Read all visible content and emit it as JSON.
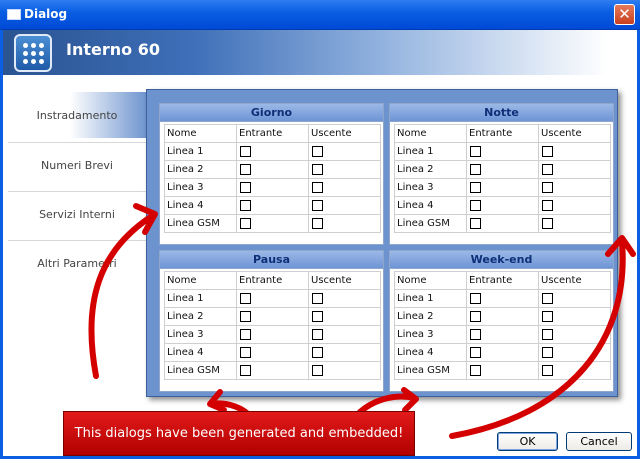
{
  "window": {
    "title": "Dialog",
    "close_label": "✕"
  },
  "header": {
    "title": "Interno 60"
  },
  "nav": {
    "items": [
      {
        "label": "Instradamento",
        "active": true
      },
      {
        "label": "Numeri Brevi",
        "active": false
      },
      {
        "label": "Servizi Interni",
        "active": false
      },
      {
        "label": "Altri Parametri",
        "active": false
      }
    ]
  },
  "columns": {
    "name": "Nome",
    "in": "Entrante",
    "out": "Uscente"
  },
  "groups": [
    {
      "title": "Giorno",
      "rows": [
        "Linea 1",
        "Linea 2",
        "Linea 3",
        "Linea 4",
        "Linea GSM"
      ]
    },
    {
      "title": "Notte",
      "rows": [
        "Linea 1",
        "Linea 2",
        "Linea 3",
        "Linea 4",
        "Linea GSM"
      ]
    },
    {
      "title": "Pausa",
      "rows": [
        "Linea 1",
        "Linea 2",
        "Linea 3",
        "Linea 4",
        "Linea GSM"
      ]
    },
    {
      "title": "Week-end",
      "rows": [
        "Linea 1",
        "Linea 2",
        "Linea 3",
        "Linea 4",
        "Linea GSM"
      ]
    }
  ],
  "annotation": {
    "text": "This dialogs have been generated and embedded!",
    "color": "#d40000"
  },
  "buttons": {
    "ok": "OK",
    "cancel": "Cancel"
  }
}
